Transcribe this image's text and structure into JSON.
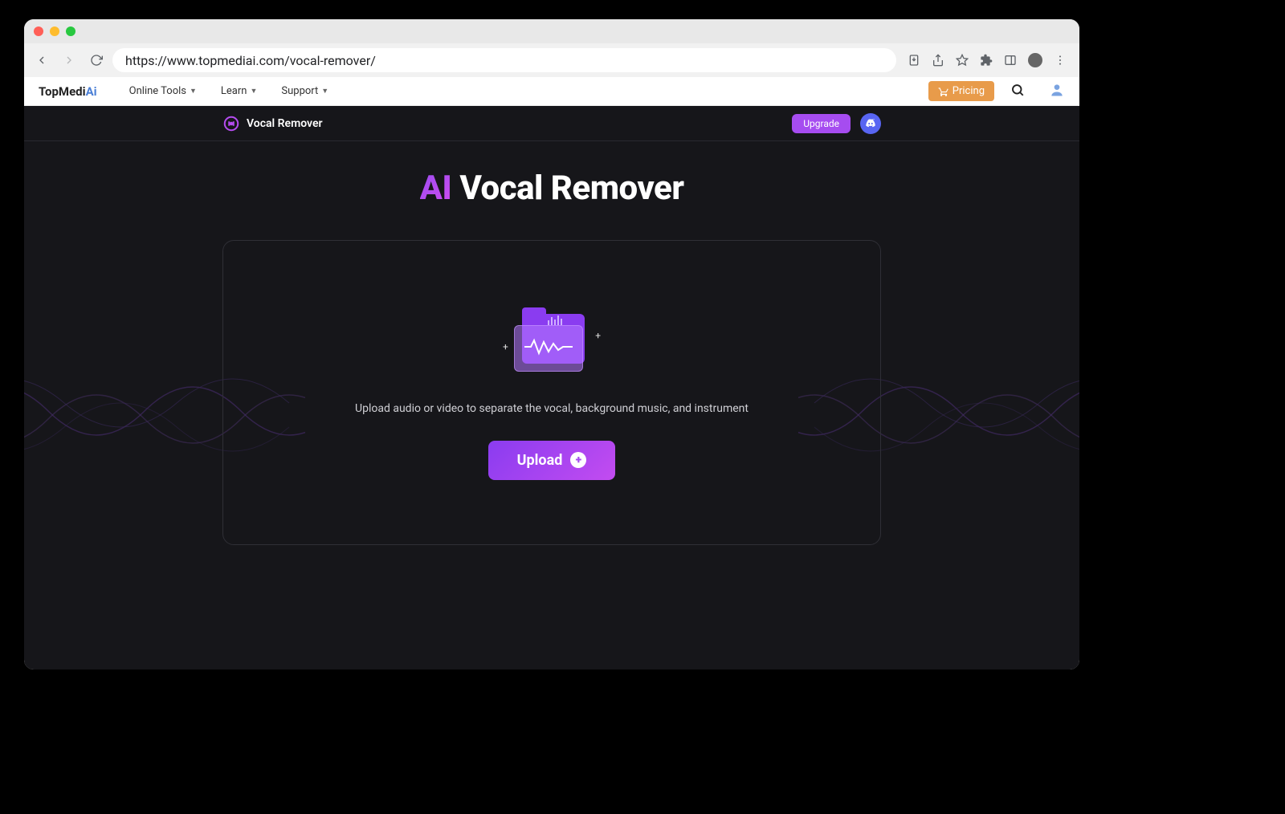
{
  "browser": {
    "url": "https://www.topmediai.com/vocal-remover/"
  },
  "header": {
    "brand_prefix": "TopMedi",
    "brand_suffix": "Ai",
    "nav": {
      "online_tools": "Online Tools",
      "learn": "Learn",
      "support": "Support"
    },
    "pricing_label": "Pricing"
  },
  "subheader": {
    "title": "Vocal Remover",
    "upgrade_label": "Upgrade"
  },
  "hero": {
    "ai_word": "AI",
    "rest": " Vocal Remover"
  },
  "panel": {
    "description": "Upload audio or video to separate the vocal, background music, and instrument",
    "upload_label": "Upload"
  }
}
